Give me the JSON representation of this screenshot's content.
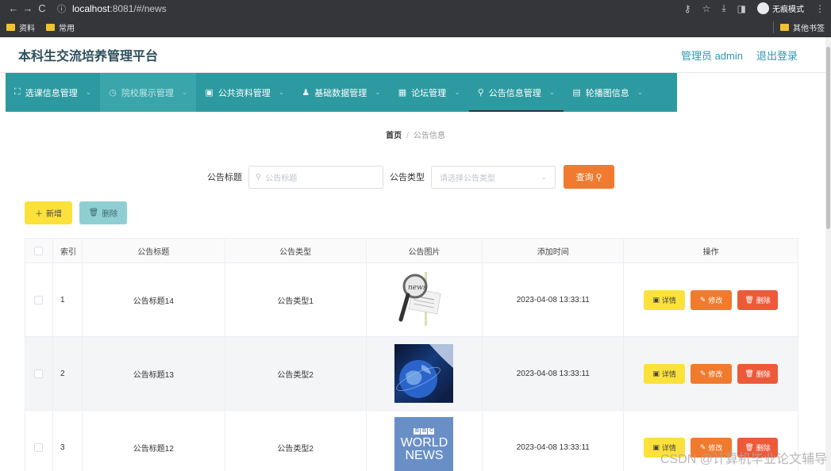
{
  "browser": {
    "url_host": "localhost",
    "url_rest": ":8081/#/news",
    "incognito_label": "无痕模式",
    "bookmarks": [
      "资料",
      "常用"
    ],
    "other_bookmarks": "其他书签"
  },
  "header": {
    "title": "本科生交流培养管理平台",
    "user": "管理员 admin",
    "logout": "退出登录"
  },
  "menu": [
    {
      "label": "选课信息管理",
      "icon": "expand-icon"
    },
    {
      "label": "院校展示管理",
      "icon": "clock-icon"
    },
    {
      "label": "公共资料管理",
      "icon": "folder-icon"
    },
    {
      "label": "基础数据管理",
      "icon": "user-icon"
    },
    {
      "label": "论坛管理",
      "icon": "grid-icon"
    },
    {
      "label": "公告信息管理",
      "icon": "pin-icon"
    },
    {
      "label": "轮播图信息",
      "icon": "image-icon"
    }
  ],
  "breadcrumb": {
    "home": "首页",
    "current": "公告信息"
  },
  "search": {
    "title_label": "公告标题",
    "title_placeholder": "公告标题",
    "type_label": "公告类型",
    "type_placeholder": "请选择公告类型",
    "query_btn": "查询"
  },
  "actions": {
    "add": "新增",
    "delete": "删除"
  },
  "table": {
    "headers": [
      "索引",
      "公告标题",
      "公告类型",
      "公告图片",
      "添加时间",
      "操作"
    ],
    "rows": [
      {
        "index": "1",
        "title": "公告标题14",
        "type": "公告类型1",
        "image": "news-magnifier",
        "time": "2023-04-08 13:33:11"
      },
      {
        "index": "2",
        "title": "公告标题13",
        "type": "公告类型2",
        "image": "globe",
        "time": "2023-04-08 13:33:11"
      },
      {
        "index": "3",
        "title": "公告标题12",
        "type": "公告类型2",
        "image": "bbc-world-news",
        "time": "2023-04-08 13:33:11"
      }
    ],
    "ops": {
      "detail": "详情",
      "edit": "修改",
      "delete": "删除"
    }
  },
  "bbc": {
    "logo": [
      "B",
      "B",
      "C"
    ],
    "line1": "WORLD",
    "line2": "NEWS"
  },
  "watermark": "CSDN @计算机毕业论文辅导",
  "colors": {
    "menu_bg": "#2c9aa0",
    "query": "#f07a2e",
    "add": "#fbe13a",
    "danger": "#ec5a3a"
  }
}
